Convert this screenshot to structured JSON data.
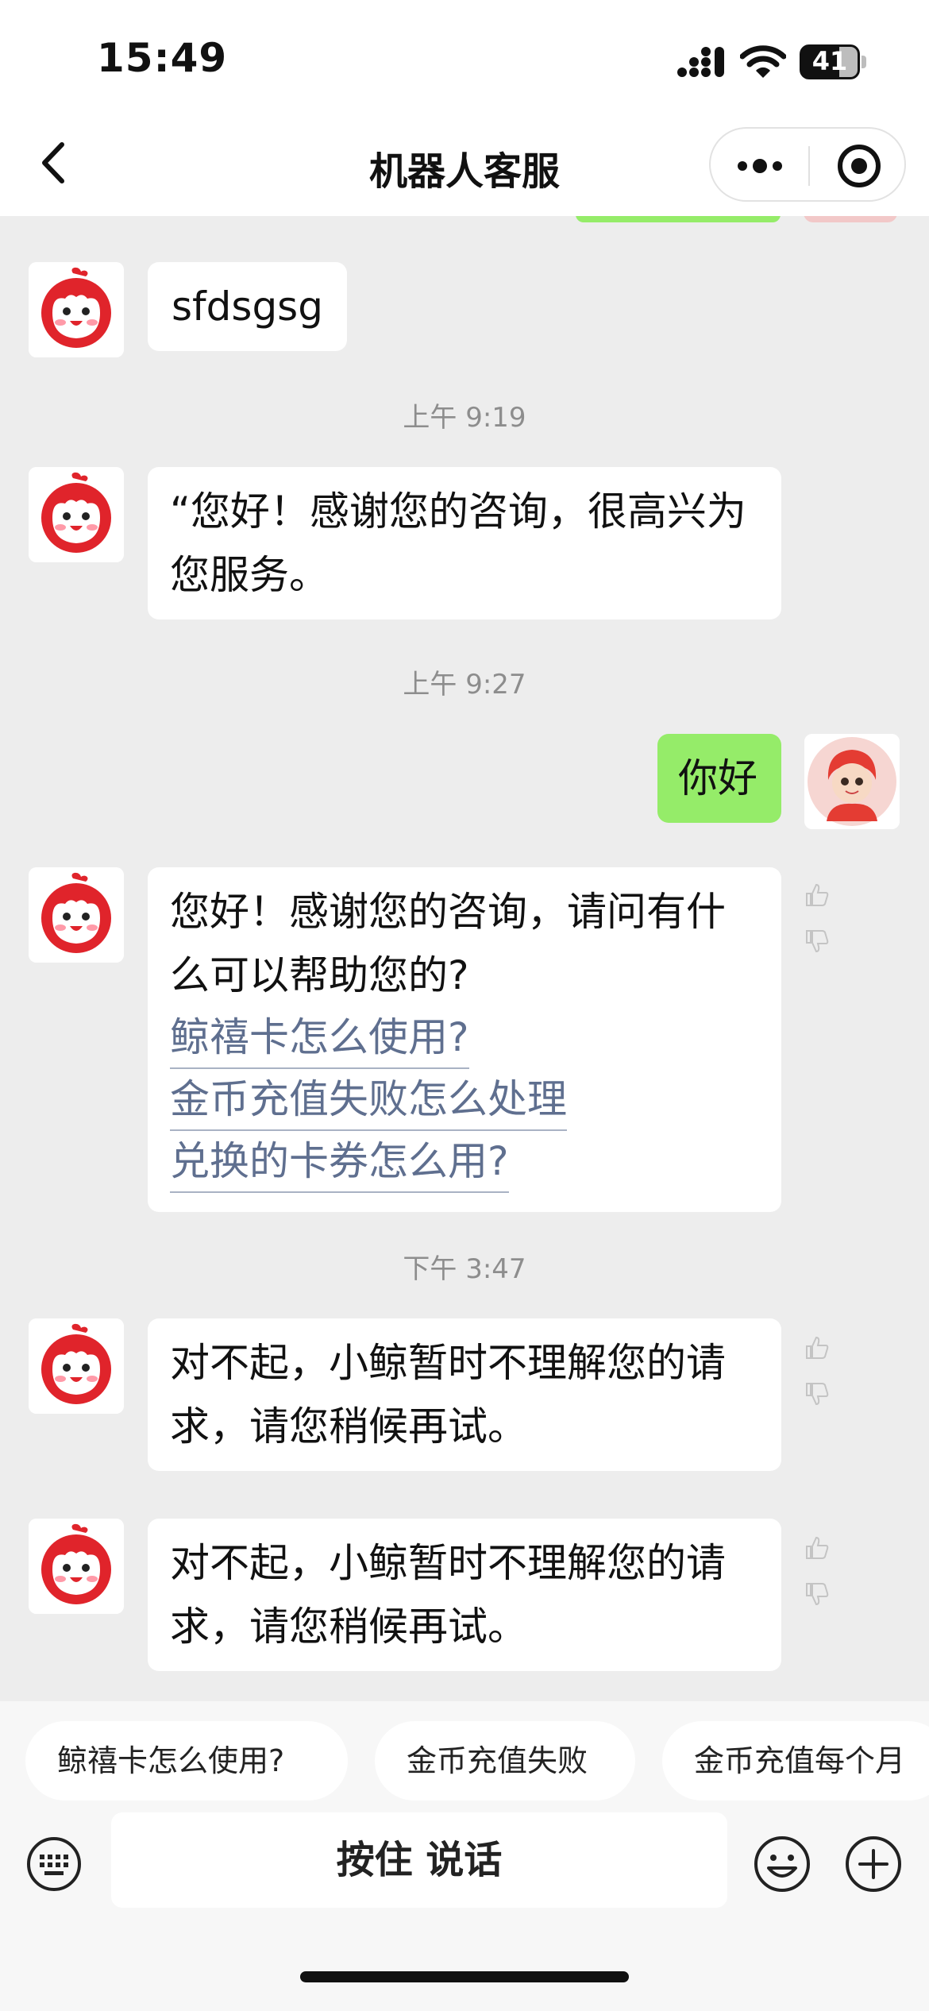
{
  "status_bar": {
    "time": "15:49",
    "battery": "41",
    "battery_level": 0.41
  },
  "nav": {
    "title": "机器人客服"
  },
  "messages": {
    "m1": {
      "text": "sfdsgsg"
    },
    "ts1": "上午 9:19",
    "m2": {
      "line1": "“您好！感谢您的咨询，很高兴为",
      "line2": "您服务。"
    },
    "ts2": "上午 9:27",
    "m3": {
      "text": "你好"
    },
    "m4": {
      "line1": "您好！感谢您的咨询，请问有什",
      "line2": "么可以帮助您的?",
      "links": [
        "鲸禧卡怎么使用?",
        "金币充值失败怎么处理",
        "兑换的卡券怎么用?"
      ]
    },
    "ts3": "下午 3:47",
    "m5": {
      "line1": "对不起，小鲸暂时不理解您的请",
      "line2": "求，请您稍候再试。"
    },
    "m6": {
      "line1": "对不起，小鲸暂时不理解您的请",
      "line2": "求，请您稍候再试。"
    }
  },
  "quick_replies": [
    "鲸禧卡怎么使用?",
    "金币充值失败",
    "金币充值每个月"
  ],
  "input": {
    "talk_label": "按住 说话"
  },
  "colors": {
    "accent_green": "#95ec69",
    "link": "#5f6f8f",
    "bot_red": "#e0242b"
  }
}
